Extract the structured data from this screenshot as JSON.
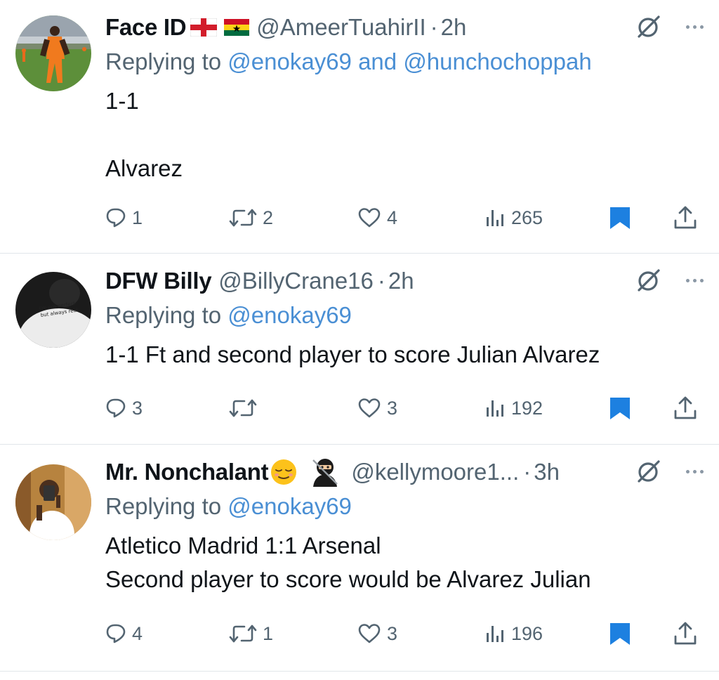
{
  "replying_prefix": "Replying to",
  "tweets": [
    {
      "name": "Face ID",
      "handle": "@AmeerTuahirII",
      "dot": "·",
      "time": "2h",
      "mention1": "@enokay69",
      "and_word": "and",
      "mention2": "@hunchochoppah",
      "text": "1-1\n\nAlvarez",
      "emojis": [
        "england-flag-icon",
        "ghana-flag-icon"
      ],
      "counts": {
        "replies": "1",
        "retweets": "2",
        "likes": "4",
        "views": "265"
      }
    },
    {
      "name": "DFW Billy",
      "handle": "@BillyCrane16",
      "dot": "·",
      "time": "2h",
      "mention1": "@enokay69",
      "text": "1-1 Ft and second player to score Julian Alvarez",
      "avatar_text": "i'm not perfect but always real",
      "counts": {
        "replies": "3",
        "retweets": "",
        "likes": "3",
        "views": "192"
      }
    },
    {
      "name": "Mr. Nonchalant",
      "handle": "@kellymoore1...",
      "dot": "·",
      "time": "3h",
      "mention1": "@enokay69",
      "text": "Atletico Madrid 1:1 Arsenal\nSecond player to score would be Alvarez Julian",
      "emojis": [
        "relieved-face-icon",
        "ninja-icon"
      ],
      "counts": {
        "replies": "4",
        "retweets": "1",
        "likes": "3",
        "views": "196"
      }
    }
  ],
  "colors": {
    "mention": "#4a8fd4",
    "secondary": "#536471",
    "bookmark": "#1d80e0",
    "divider": "#e1e6ea"
  }
}
